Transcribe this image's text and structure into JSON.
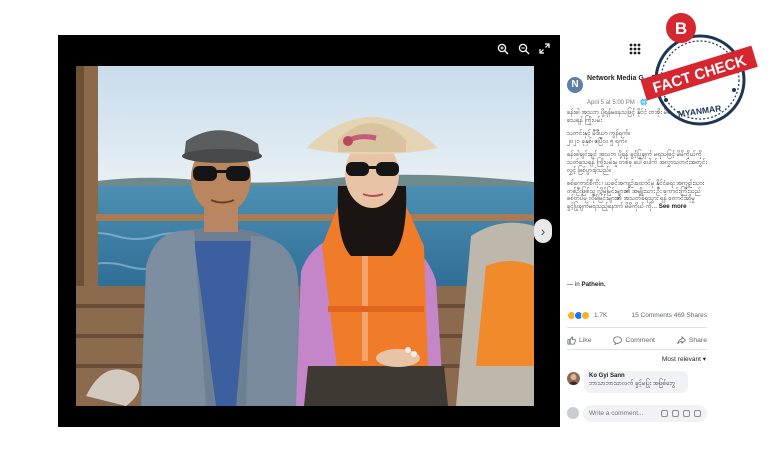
{
  "viewer": {
    "zoom_in_icon": "zoom-in-icon",
    "zoom_out_icon": "zoom-out-icon",
    "fullscreen_icon": "fullscreen-icon",
    "next_arrow": "›"
  },
  "badge": {
    "letter": "B",
    "top_text": "FACT CHECK",
    "bottom_text": "MYANMAR",
    "colors": {
      "red": "#d62630",
      "navy": "#1d3557"
    }
  },
  "post": {
    "page_name": "Network Media G... Page",
    "date": "April 5 at 5:00 PM · 🌐",
    "avatar_letter": "N",
    "paragraphs": [
      "ခန်းဓါ အသဘ ပို့ရန်မနေသဖြင့် နိုင်ငံ တအိုး မိမိကိုယ်ကို သတိသေရန် ကြိုးပမ်း",
      "သတင်းနှင့် မီဒီယာ ကွန်ရက်။\n၂၀၂၁ ခုနှစ်၊ ဧပြီလ ၅ ရက်။",
      "ခန်းဓါချင်းချင် အသဘ ပို့ရန် ခွင့်ပြုချက် မရသဖြင့် မိမိကိုယ်ကို သတ်သေရန် ကြိုးပမ်းမှု တစ်ခု ပေါ်ပေါက် အလွှာသတင်းအတွင်းလွှင့် ဖြစ်ပွားခဲ့သည်။",
      "စစ်ကောင်စီကိုး ၊ ယခင်အကျဉ်းထောင်မှ နိုင်ငံရေး အကျဉ်းသား တစ်ဦးဖြစ်သူ လိုမ်မြင်းများ၏ အမျိုးသား ဦး ကောင်းကြီးသည် စစ်တပ်မှ လိုမ်မြင်းများ၏ အသတ်ခံရသွား ရန် တောင်းဆိုမှု ခွင့်ပြုချက်မရသည့်နောက် မိမိကိုယ် ကို..."
    ],
    "see_more": "See more",
    "location_prefix": "— in",
    "location": "Pathein.",
    "reaction_count": "1.7K",
    "comments": "15 Comments",
    "shares": "469 Shares",
    "actions": {
      "like": "Like",
      "comment": "Comment",
      "share": "Share"
    },
    "sort": "Most relevant ▾",
    "comment_item": {
      "name": "Ko Gyi Sann",
      "text": "ဘာသာဘာသာလက် ခွင့်မပြုး အဖြစ်ဘွေ"
    },
    "write_placeholder": "Write a comment..."
  }
}
